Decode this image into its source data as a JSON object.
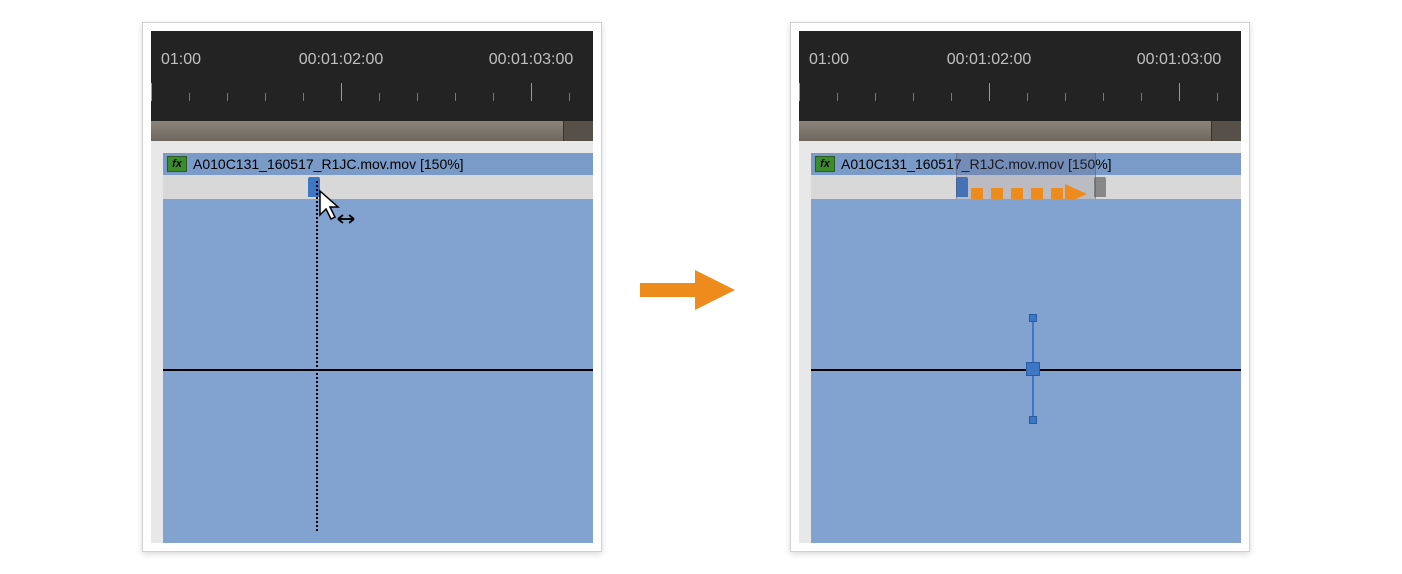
{
  "ruler": {
    "labels": [
      "01:00",
      "00:01:02:00",
      "00:01:03:00"
    ],
    "label_positions": [
      0,
      190,
      380
    ]
  },
  "clip": {
    "fx_label": "fx",
    "title": "A010C131_160517_R1JC.mov.mov [150%]"
  },
  "colors": {
    "accent_orange": "#ed8b1c",
    "clip_blue": "#82a3d0",
    "handle_blue": "#3b77c4"
  }
}
